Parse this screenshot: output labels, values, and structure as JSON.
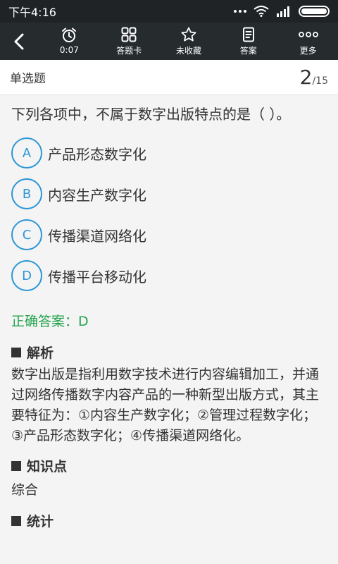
{
  "status": {
    "time": "下午4:16"
  },
  "toolbar": {
    "items": [
      {
        "label": "0:07",
        "icon": "alarm-clock-icon"
      },
      {
        "label": "答题卡",
        "icon": "grid-icon"
      },
      {
        "label": "未收藏",
        "icon": "star-icon"
      },
      {
        "label": "答案",
        "icon": "document-icon"
      },
      {
        "label": "更多",
        "icon": "more-dots-icon"
      }
    ]
  },
  "header": {
    "question_type": "单选题",
    "current": "2",
    "total": "/15"
  },
  "question": {
    "text": "下列各项中，不属于数字出版特点的是（ ）。"
  },
  "options": [
    {
      "key": "A",
      "text": "产品形态数字化"
    },
    {
      "key": "B",
      "text": "内容生产数字化"
    },
    {
      "key": "C",
      "text": "传播渠道网络化"
    },
    {
      "key": "D",
      "text": "传播平台移动化"
    }
  ],
  "answer": {
    "text": "正确答案：D"
  },
  "analysis": {
    "title": "解析",
    "text": "数字出版是指利用数字技术进行内容编辑加工，并通过网络传播数字内容产品的一种新型出版方式，其主要特征为：①内容生产数字化；②管理过程数字化；③产品形态数字化；④传播渠道网络化。"
  },
  "knowledge": {
    "title": "知识点",
    "text": "综合"
  },
  "stats": {
    "title": "统计"
  },
  "colors": {
    "accent": "#2b96d6",
    "correct": "#22a34a",
    "toolbar": "#262b2e"
  }
}
